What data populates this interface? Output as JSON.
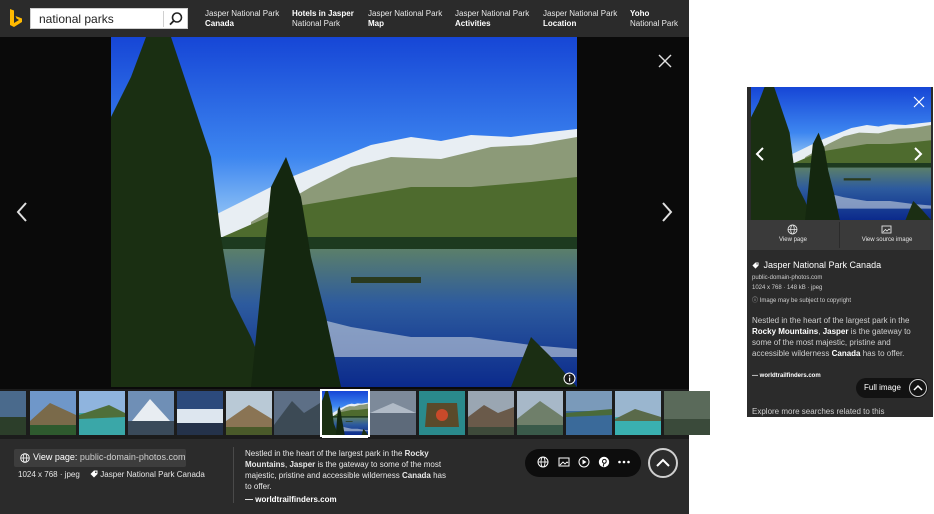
{
  "search": {
    "query": "national parks"
  },
  "related_searches": [
    {
      "line1": "Jasper National Park",
      "line2": "Canada",
      "bold_line": 2
    },
    {
      "line1": "Hotels in Jasper",
      "line2": "National Park",
      "bold_line": 1
    },
    {
      "line1": "Jasper National Park",
      "line2": "Map",
      "bold_line": 2
    },
    {
      "line1": "Jasper National Park",
      "line2": "Activities",
      "bold_line": 2
    },
    {
      "line1": "Jasper National Park",
      "line2": "Location",
      "bold_line": 2
    },
    {
      "line1": "Yoho",
      "line2": "National Park",
      "bold_line": 1
    }
  ],
  "image_info": {
    "view_page_label": "View page:",
    "domain": "public-domain-photos.com",
    "dimensions": "1024 x 768",
    "format": "jpeg",
    "title": "Jasper National Park Canada",
    "size": "148 kB"
  },
  "description": {
    "segments": [
      {
        "text": "Nestled in the heart of the largest park in the ",
        "bold": false
      },
      {
        "text": "Rocky Mountains",
        "bold": true
      },
      {
        "text": ", ",
        "bold": false
      },
      {
        "text": "Jasper",
        "bold": true
      },
      {
        "text": " is the gateway to some of the most majestic, pristine and accessible wilderness ",
        "bold": false
      },
      {
        "text": "Canada",
        "bold": true
      },
      {
        "text": " has to offer.",
        "bold": false
      }
    ],
    "source": "— worldtrailfinders.com"
  },
  "actions": [
    "globe-icon",
    "image-icon",
    "play-icon",
    "pinterest-icon",
    "more-icon"
  ],
  "mobile": {
    "view_page": "View page",
    "view_source": "View source image",
    "title": "Jasper National Park Canada",
    "domain": "public-domain-photos.com",
    "size_line": "1024 x 768 · 148 kB · jpeg",
    "copyright": "ⓘ Image may be subject to copyright",
    "source": "— worldtrailfinders.com",
    "full_image": "Full image",
    "explore": "Explore more searches related to this"
  },
  "colors": {
    "accent": "#ffb900",
    "dark_bg": "#2b2b2b"
  }
}
